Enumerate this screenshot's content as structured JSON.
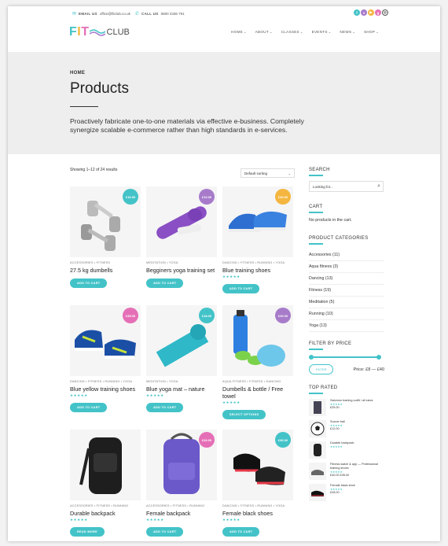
{
  "topbar": {
    "email_label": "EMAIL US",
    "email_value": "office@fitclub.co.uk",
    "call_label": "CALL US",
    "call_value": "0800 2336 791",
    "social_icons": [
      "facebook-icon",
      "vimeo-icon",
      "youtube-icon",
      "googleplus-icon",
      "dribbble-icon"
    ]
  },
  "brand": {
    "fit": "FIT",
    "club": "CLUB"
  },
  "nav": [
    "HOME",
    "ABOUT",
    "CLASSES",
    "EVENTS",
    "NEWS",
    "SHOP"
  ],
  "hero": {
    "breadcrumb": "HOME",
    "title": "Products",
    "lead": "Proactively fabricate one-to-one materials via effective e-business. Completely synergize scalable e-commerce rather than high standards in e-services."
  },
  "shop": {
    "result_count": "Showing 1–12 of 24 results",
    "sort_label": "Default sorting",
    "products": [
      {
        "cat": "ACCESSORIES • FITNESS",
        "name": "27.5 kg dumbells",
        "price": "£16.00",
        "badge": "#43c3c8",
        "btn": "ADD TO CART",
        "stars": ""
      },
      {
        "cat": "MEDITATION • YOGA",
        "name": "Begginers yoga training set",
        "price": "£12.00",
        "badge": "#a77bca",
        "btn": "ADD TO CART",
        "stars": ""
      },
      {
        "cat": "DANCING • FITNESS • RUNNING • YOGA",
        "name": "Blue training shoes",
        "price": "£32.00",
        "badge": "#f4b63f",
        "btn": "ADD TO CART",
        "stars": "★★★★★"
      },
      {
        "cat": "DANCING • FITNESS • RUNNING • YOGA",
        "name": "Blue yellow training shoes",
        "price": "£35.00",
        "badge": "#e56fb6",
        "btn": "ADD TO CART",
        "stars": "★★★★★"
      },
      {
        "cat": "MEDITATION • YOGA",
        "name": "Blue yoga mat – nature",
        "price": "£18.00",
        "badge": "#43c3c8",
        "btn": "ADD TO CART",
        "stars": "★★★★★"
      },
      {
        "cat": "AQUA FITNESS • FITNESS • DANCING",
        "name": "Dumbells & bottle / Free towel",
        "price": "£20.00",
        "badge": "#a77bca",
        "btn": "SELECT OPTIONS",
        "stars": "★★★★★"
      },
      {
        "cat": "ACCESSORIES • FITNESS • RUNNING",
        "name": "Durable backpack",
        "price": "",
        "badge": "",
        "btn": "READ MORE",
        "stars": "★★★★★"
      },
      {
        "cat": "ACCESSORIES • FITNESS • RUNNING",
        "name": "Female backpack",
        "price": "£26.00",
        "badge": "#e56fb6",
        "btn": "ADD TO CART",
        "stars": "★★★★★"
      },
      {
        "cat": "DANCING • FITNESS • RUNNING • YOGA",
        "name": "Female black shoes",
        "price": "£30.00",
        "badge": "#43c3c8",
        "btn": "ADD TO CART",
        "stars": "★★★★★"
      }
    ]
  },
  "sidebar": {
    "search_title": "SEARCH",
    "search_placeholder": "Looking for...",
    "cart_title": "CART",
    "cart_empty": "No products in the cart.",
    "cats_title": "PRODUCT CATEGORIES",
    "categories": [
      "Accessories (11)",
      "Aqua fitness (3)",
      "Dancing (13)",
      "Fitness (19)",
      "Meditation (5)",
      "Running (10)",
      "Yoga (13)"
    ],
    "filter_title": "FILTER BY PRICE",
    "filter_btn": "FILTER",
    "price_range": "Price: £8 — £40",
    "top_title": "TOP RATED",
    "top_rated": [
      {
        "name": "Salomon training outfit / all sizes",
        "stars": "★★★★★",
        "price": "£25.00"
      },
      {
        "name": "Soccer ball",
        "stars": "★★★★★",
        "price": "£12.00"
      },
      {
        "name": "Durable backpack",
        "stars": "★★★★★",
        "price": ""
      },
      {
        "name": "Fitness watch & app — Professional training shoes",
        "stars": "★★★★★",
        "price": "£40.00 £35.00"
      },
      {
        "name": "Female black shoe",
        "stars": "★★★★★",
        "price": "£28.00"
      }
    ]
  },
  "colors": {
    "accent": "#43c3c8",
    "purple": "#a77bca",
    "orange": "#f4b63f",
    "pink": "#e56fb6"
  }
}
